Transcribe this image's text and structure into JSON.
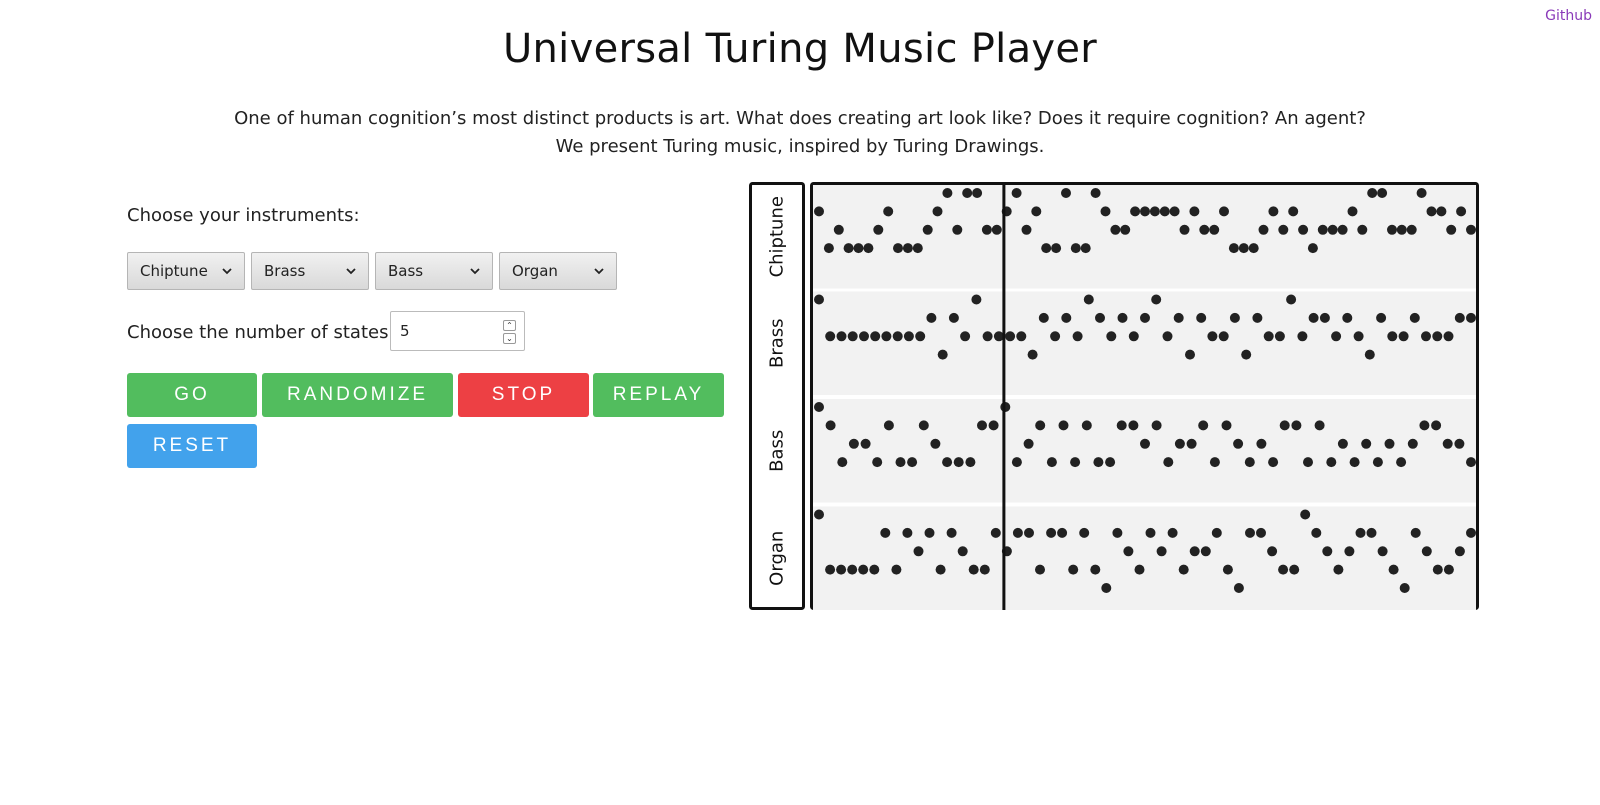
{
  "header": {
    "github_link": "Github",
    "title": "Universal Turing Music Player"
  },
  "intro": {
    "line1": "One of human cognition’s most distinct products is art. What does creating art look like? Does it require cognition? An agent?",
    "line2": "We present Turing music, inspired by Turing Drawings."
  },
  "controls": {
    "instruments_label": "Choose your instruments:",
    "instrument_selects": [
      "Chiptune",
      "Brass",
      "Bass",
      "Organ"
    ],
    "states_label": "Choose the number of states:",
    "states_value": "5",
    "buttons": {
      "go": "GO",
      "randomize": "RANDOMIZE",
      "stop": "STOP",
      "replay": "REPLAY",
      "reset": "RESET"
    },
    "colors": {
      "go": "#52bd5e",
      "randomize": "#52bd5e",
      "stop": "#ed4044",
      "replay": "#52bd5e",
      "reset": "#42a2ec"
    }
  },
  "player": {
    "tracks": [
      "Chiptune",
      "Brass",
      "Bass",
      "Organ"
    ],
    "levels_per_track": 4,
    "playhead_step": 9.5,
    "total_steps": 33,
    "notes": [
      [
        1,
        3,
        2,
        3,
        3,
        3,
        2,
        1,
        3,
        3,
        3,
        2,
        1,
        0,
        2,
        0,
        0,
        2,
        2,
        1,
        0,
        2,
        1,
        3,
        3,
        0,
        3,
        3,
        0,
        1,
        2,
        2,
        1,
        1,
        1,
        1,
        1,
        2,
        1,
        2,
        2,
        1,
        3,
        3,
        3,
        2,
        1,
        2,
        1,
        2,
        3,
        2,
        2,
        2,
        1,
        2,
        0,
        0,
        2,
        2,
        2,
        0,
        1,
        1,
        2,
        1,
        2
      ],
      [
        0,
        2,
        2,
        2,
        2,
        2,
        2,
        2,
        2,
        2,
        1,
        3,
        1,
        2,
        0,
        2,
        2,
        2,
        2,
        3,
        1,
        2,
        1,
        2,
        0,
        1,
        2,
        1,
        2,
        1,
        0,
        2,
        1,
        3,
        1,
        2,
        2,
        1,
        3,
        1,
        2,
        2,
        0,
        2,
        1,
        1,
        2,
        1,
        2,
        3,
        1,
        2,
        2,
        1,
        2,
        2,
        2,
        1,
        1
      ],
      [
        0,
        1,
        3,
        2,
        2,
        3,
        1,
        3,
        3,
        1,
        2,
        3,
        3,
        3,
        1,
        1,
        0,
        3,
        2,
        1,
        3,
        1,
        3,
        1,
        3,
        3,
        1,
        1,
        2,
        1,
        3,
        2,
        2,
        1,
        3,
        1,
        2,
        3,
        2,
        3,
        1,
        1,
        3,
        1,
        3,
        2,
        3,
        2,
        3,
        2,
        3,
        2,
        1,
        1,
        2,
        2,
        3
      ],
      [
        0,
        3,
        3,
        3,
        3,
        3,
        1,
        3,
        1,
        2,
        1,
        3,
        1,
        2,
        3,
        3,
        1,
        2,
        1,
        1,
        3,
        1,
        1,
        3,
        1,
        3,
        4,
        1,
        2,
        3,
        1,
        2,
        1,
        3,
        2,
        2,
        1,
        3,
        4,
        1,
        1,
        2,
        3,
        3,
        0,
        1,
        2,
        3,
        2,
        1,
        1,
        2,
        3,
        4,
        1,
        2,
        3,
        3,
        2,
        1
      ]
    ]
  }
}
